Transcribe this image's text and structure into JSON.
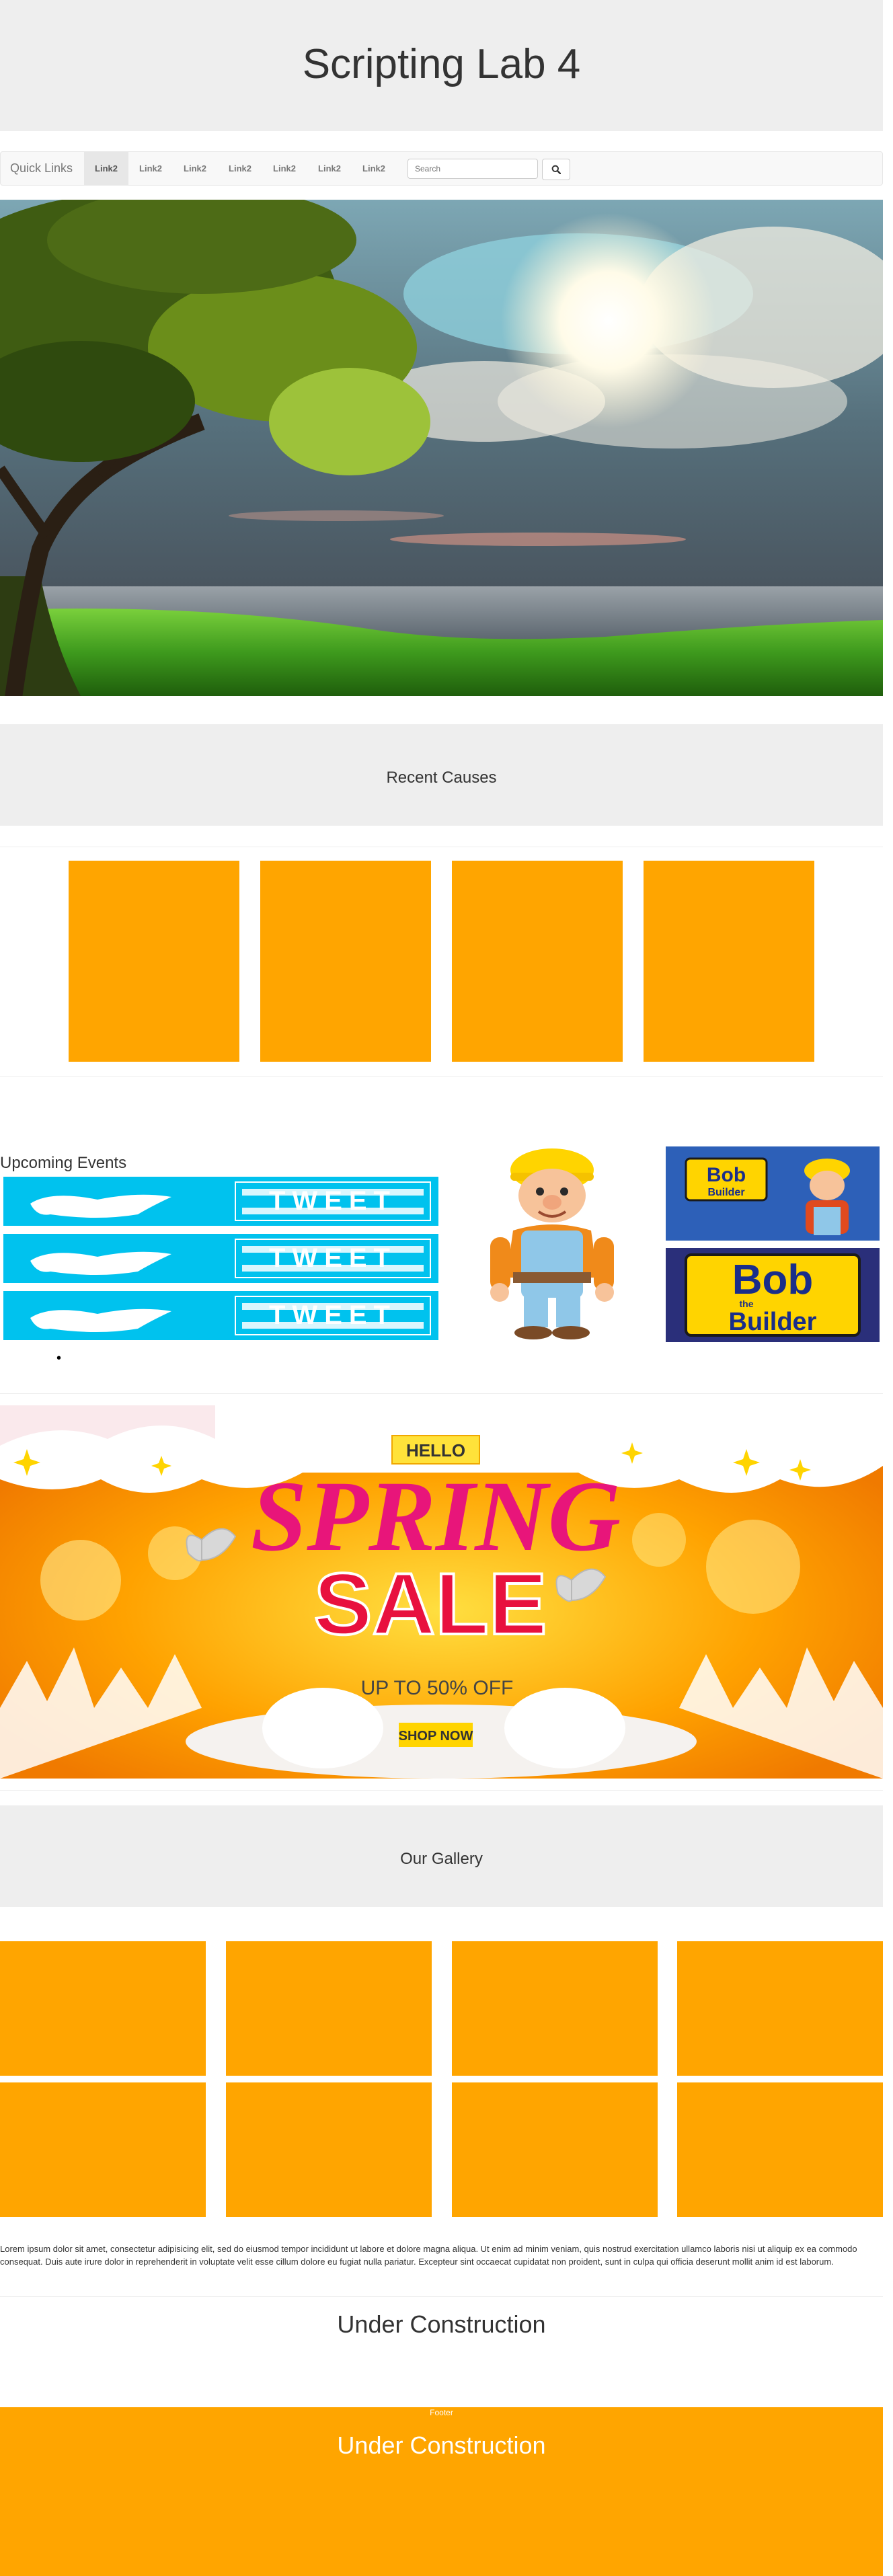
{
  "header": {
    "title": "Scripting Lab 4"
  },
  "navbar": {
    "brand": "Quick Links",
    "links": [
      "Link2",
      "Link2",
      "Link2",
      "Link2",
      "Link2",
      "Link2",
      "Link2"
    ],
    "active_index": 0,
    "search": {
      "placeholder": "Search",
      "value": ""
    },
    "search_icon": "search-icon"
  },
  "hero": {
    "description_icon": "landscape-image"
  },
  "causes": {
    "title": "Recent Causes",
    "card_count": 4,
    "card_color": "#ffa500"
  },
  "events": {
    "title": "Upcoming Events",
    "tweet_banner_text": "TWEET",
    "bob_logo_line1": "Bob",
    "bob_logo_line2": "the",
    "bob_logo_line3": "Builder",
    "bullet": "•"
  },
  "promo": {
    "hello": "HELLO",
    "spring": "SPRING",
    "sale": "SALE",
    "discount": "UP TO 50% OFF",
    "cta": "SHOP NOW"
  },
  "gallery": {
    "title": "Our Gallery",
    "tile_count": 8,
    "tile_color": "#ffa500"
  },
  "lorem": "Lorem ipsum dolor sit amet, consectetur adipisicing elit, sed do eiusmod tempor incididunt ut labore et dolore magna aliqua. Ut enim ad minim veniam, quis nostrud exercitation ullamco laboris nisi ut aliquip ex ea commodo consequat. Duis aute irure dolor in reprehenderit in voluptate velit esse cillum dolore eu fugiat nulla pariatur. Excepteur sint occaecat cupidatat non proident, sunt in culpa qui officia deserunt mollit anim id est laborum.",
  "construction": {
    "text": "Under Construction"
  },
  "footer": {
    "label": "Footer",
    "text": "Under Construction",
    "color": "#ffa500"
  },
  "colors": {
    "accent": "#ffa500",
    "band": "#eeeeee",
    "twitter": "#00c2ee"
  }
}
